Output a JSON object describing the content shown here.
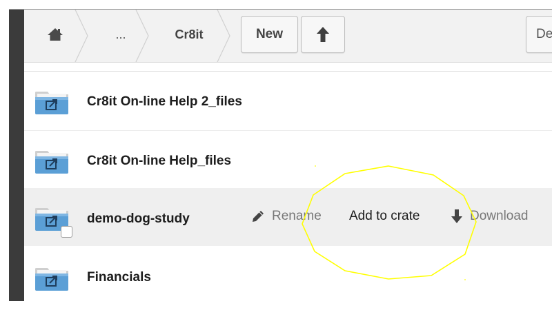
{
  "breadcrumb": {
    "home_icon": "home-icon",
    "ellipsis": "...",
    "current": "Cr8it"
  },
  "toolbar": {
    "new_label": "New",
    "upload_icon": "upload-arrow-icon",
    "truncated_right_label": "De"
  },
  "files": [
    {
      "name": "Cr8it On-line Help 2_files",
      "icon": "shared-folder-icon"
    },
    {
      "name": "Cr8it On-line Help_files",
      "icon": "shared-folder-icon"
    },
    {
      "name": "demo-dog-study",
      "icon": "shared-folder-icon",
      "hovered": true,
      "actions": {
        "rename": "Rename",
        "add_to_crate": "Add to crate",
        "download": "Download"
      }
    },
    {
      "name": "Financials",
      "icon": "shared-folder-icon"
    }
  ],
  "colors": {
    "annotation_highlight": "#ffff00",
    "folder_blue": "#5b9fd6",
    "hover_row": "#efefef"
  }
}
